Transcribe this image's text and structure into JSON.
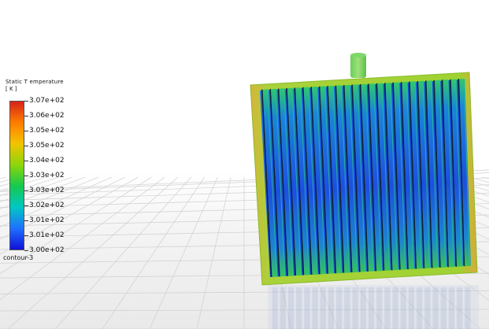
{
  "legend": {
    "title": "Static T emperature",
    "unit": "[ K ]",
    "contour_name": "contour-3",
    "ticks": [
      "3.07e+02",
      "3.06e+02",
      "3.05e+02",
      "3.05e+02",
      "3.04e+02",
      "3.03e+02",
      "3.03e+02",
      "3.02e+02",
      "3.01e+02",
      "3.01e+02",
      "3.00e+02"
    ],
    "colors": [
      "#d62419",
      "#ff7d00",
      "#f2c400",
      "#8bd60a",
      "#15c94e",
      "#00c7c4",
      "#1f70ff",
      "#1010d8"
    ]
  },
  "scene": {
    "fin_count": 25,
    "colors": {
      "frame": "#9fd233",
      "frame_edge_warm": "#d2b830",
      "core": "#1b56e8",
      "fin": "#2a6fe0",
      "fin_highlight": "#27c38a",
      "fin_dark": "#0f1f2e"
    }
  }
}
